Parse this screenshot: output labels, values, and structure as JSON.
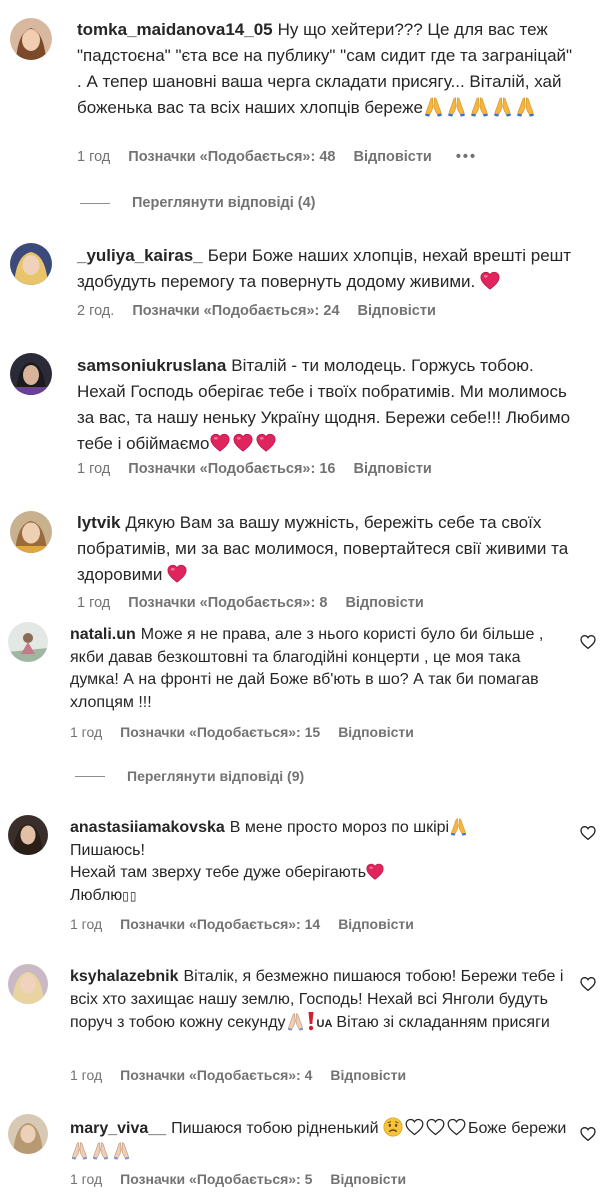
{
  "comments": [
    {
      "username": "tomka_maidanova14_05",
      "text": "Ну що хейтери??? Це для вас теж \"падстоєна\" \"єта все на публику\" \"сам сидит где та заграніцай\" . А тепер шановні ваша черга складати присягу... Віталій, хай боженька вас та всіх наших хлопців береже",
      "emoji": "🙏🙏🙏🙏🙏",
      "time": "1 год",
      "likes": "Позначки «Подобається»: 48",
      "reply": "Відповісти",
      "more": "•••"
    },
    {
      "username": "_yuliya_kairas_",
      "text": "Бери Боже наших хлопців, нехай врешті решт здобудуть перемогу та повернуть додому живими.",
      "emoji": "❤️",
      "time": "2 год.",
      "likes": "Позначки «Подобається»: 24",
      "reply": "Відповісти"
    },
    {
      "username": "samsoniukruslana",
      "text": "Віталій - ти молодець. Горжусь тобою. Нехай Господь оберігає тебе і твоїх побратимів. Ми молимось за вас, та нашу неньку Україну щодня. Бережи себе!!! Любимо тебе і обіймаємо",
      "emoji": "❤️❤️❤️",
      "time": "1 год",
      "likes": "Позначки «Подобається»: 16",
      "reply": "Відповісти"
    },
    {
      "username": "lytvik",
      "text": "Дякую Вам за вашу мужність, бережіть себе та своїх побратимів, ми за вас молимося, повертайтеся свії живими та здоровими",
      "emoji": "❤️",
      "time": "1 год",
      "likes": "Позначки «Подобається»: 8",
      "reply": "Відповісти"
    },
    {
      "username": "natali.un",
      "text": "Може я не права, але з нього користі було би більше , якби давав безкоштовні та благодійні концерти , це моя така думка! А на фронті не дай Боже вб'ють в шо? А так би помагав хлопцям !!!",
      "time": "1 год",
      "likes": "Позначки «Подобається»: 15",
      "reply": "Відповісти"
    },
    {
      "username": "anastasiiamakovska",
      "line1": "В мене просто мороз по шкірі",
      "line2": "Пишаюсь!",
      "line3": "Нехай там зверху тебе дуже оберігають",
      "line4": "Люблю",
      "boxes": "▯▯",
      "time": "1 год",
      "likes": "Позначки «Подобається»: 14",
      "reply": "Відповісти"
    },
    {
      "username": "ksyhalazebnik",
      "text": "Віталік, я безмежно пишаюся тобою! Бережи тебе і всіх хто захищає нашу землю, Господь! Нехай всі Янголи будуть поруч з тобою кожну секунду",
      "flag": "UA",
      "text2": "Вітаю зі складанням присяги",
      "time": "1 год",
      "likes": "Позначки «Подобається»: 4",
      "reply": "Відповісти"
    },
    {
      "username": "mary_viva__",
      "text": "Пишаюся тобою рідненький",
      "text2": "Боже бережи",
      "time": "1 год",
      "likes": "Позначки «Подобається»: 5",
      "reply": "Відповісти"
    }
  ],
  "view_replies_1": "Переглянути відповіді (4)",
  "view_replies_2": "Переглянути відповіді (9)",
  "colors": {
    "text": "#262626",
    "meta": "#737373",
    "heart": "#e0245e"
  },
  "icons": [
    "heart-outline-icon",
    "more-icon",
    "avatar"
  ]
}
